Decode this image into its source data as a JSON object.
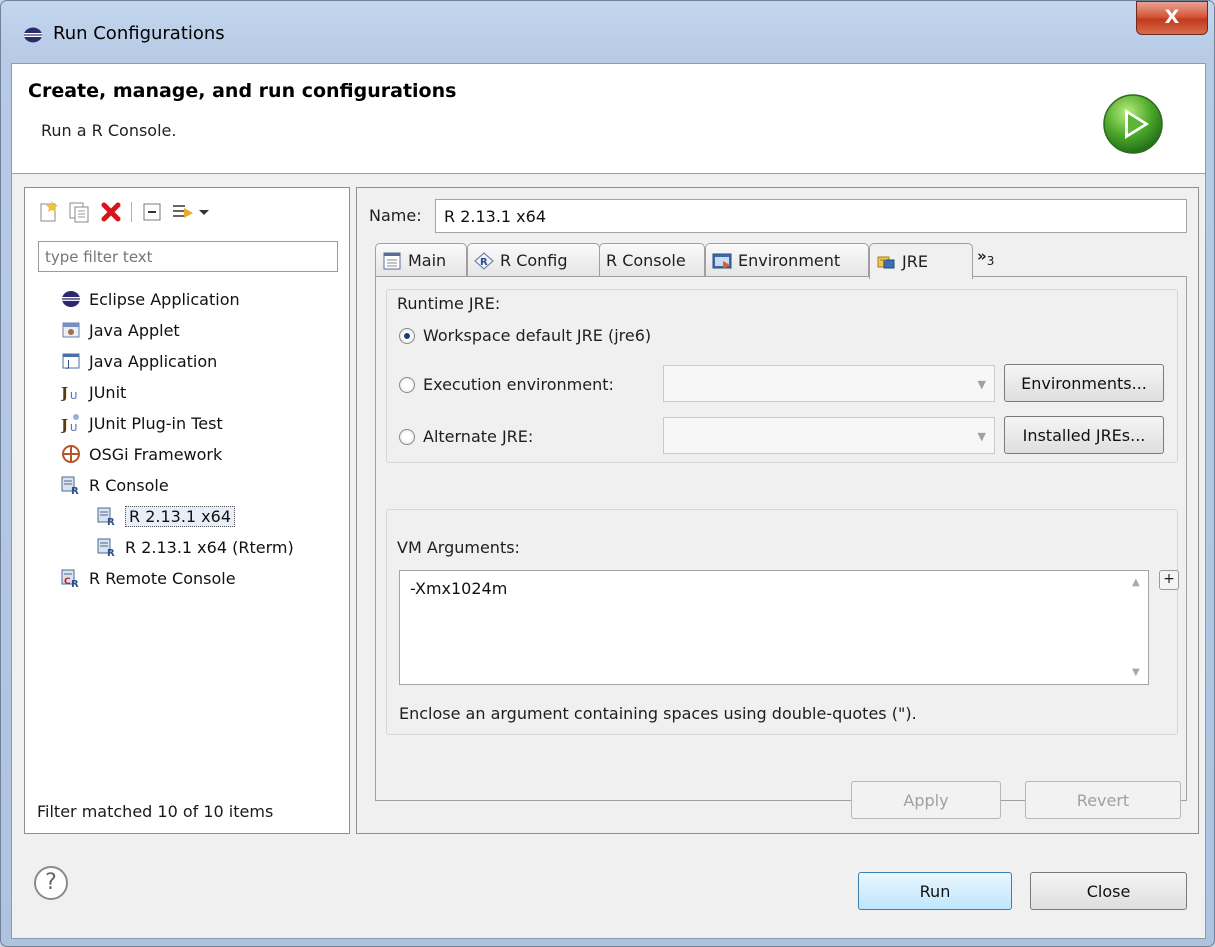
{
  "window": {
    "title": "Run Configurations",
    "close_glyph": "X"
  },
  "banner": {
    "title": "Create, manage, and run configurations",
    "description": "Run a R Console."
  },
  "left": {
    "filter_placeholder": "type filter text",
    "tree": [
      {
        "label": "Eclipse Application",
        "icon": "eclipse-icon"
      },
      {
        "label": "Java Applet",
        "icon": "java-applet-icon"
      },
      {
        "label": "Java Application",
        "icon": "java-application-icon"
      },
      {
        "label": "JUnit",
        "icon": "junit-icon"
      },
      {
        "label": "JUnit Plug-in Test",
        "icon": "junit-plugin-icon"
      },
      {
        "label": "OSGi Framework",
        "icon": "osgi-icon"
      },
      {
        "label": "R Console",
        "icon": "r-console-icon"
      },
      {
        "label": "R 2.13.1 x64",
        "icon": "r-console-icon",
        "selected": true
      },
      {
        "label": "R 2.13.1 x64 (Rterm)",
        "icon": "r-console-icon"
      },
      {
        "label": "R Remote Console",
        "icon": "r-remote-console-icon"
      }
    ],
    "status": "Filter matched 10 of 10 items"
  },
  "right": {
    "name_label": "Name:",
    "name_value": "R 2.13.1 x64",
    "tabs": [
      {
        "label": "Main",
        "icon": "main-tab-icon"
      },
      {
        "label": "R Config",
        "icon": "r-config-icon"
      },
      {
        "label": "R Console",
        "icon": ""
      },
      {
        "label": "Environment",
        "icon": "environment-icon"
      },
      {
        "label": "JRE",
        "icon": "jre-icon",
        "active": true
      }
    ],
    "tab_more": "»",
    "tab_more_count": "3",
    "runtime_jre_label": "Runtime JRE:",
    "radio_workspace": "Workspace default JRE (jre6)",
    "radio_execution": "Execution environment:",
    "radio_alternate": "Alternate JRE:",
    "environments_button": "Environments...",
    "installed_jres_button": "Installed JREs...",
    "vm_arguments_label": "VM Arguments:",
    "vm_arguments_value": "-Xmx1024m",
    "vm_plus": "+",
    "vm_hint": "Enclose an argument containing spaces using double-quotes (\").",
    "apply_button": "Apply",
    "revert_button": "Revert"
  },
  "footer": {
    "help_glyph": "?",
    "run_button": "Run",
    "close_button": "Close"
  }
}
